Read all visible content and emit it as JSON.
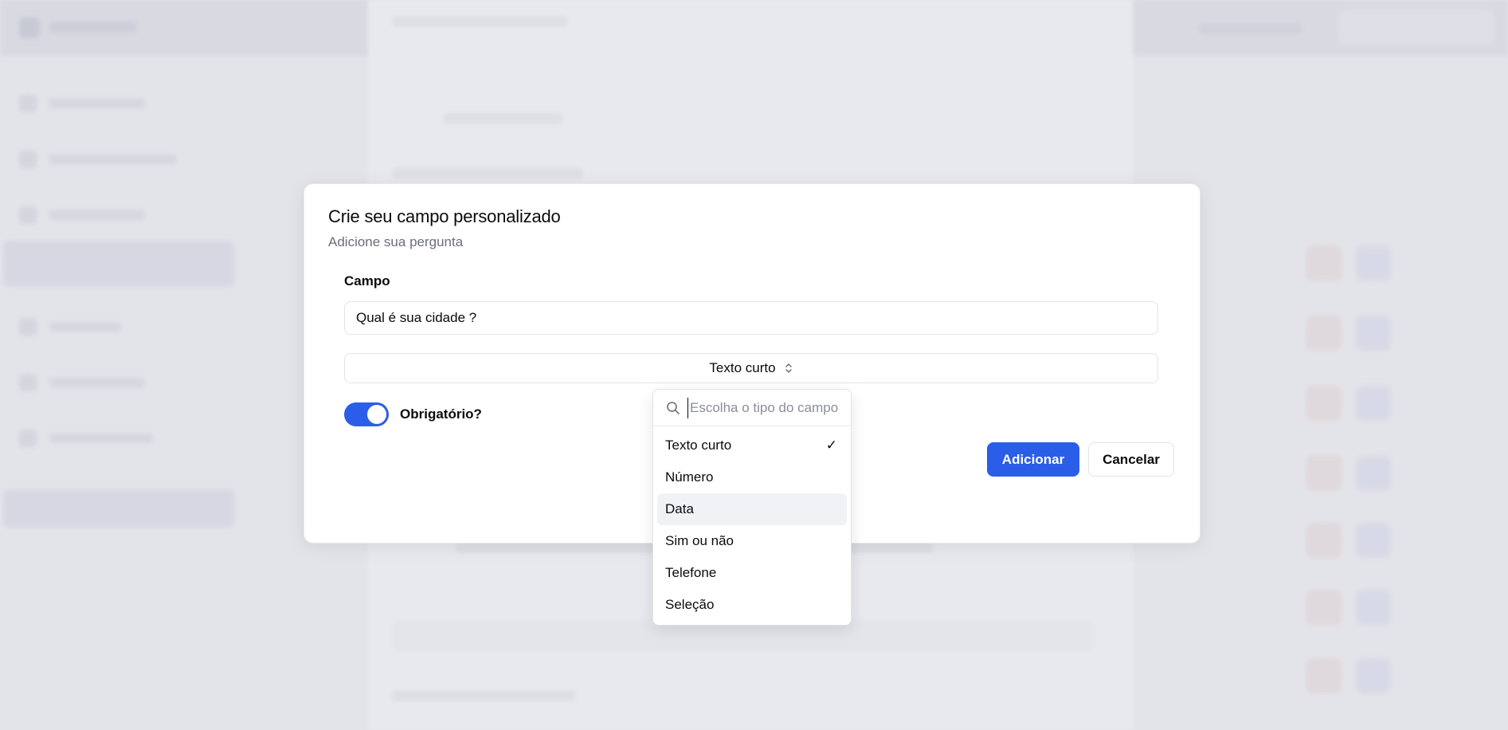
{
  "modal": {
    "title": "Crie seu campo personalizado",
    "subtitle": "Adicione sua pergunta",
    "field_label": "Campo",
    "field_value": "Qual é sua cidade ?",
    "type_selected": "Texto curto",
    "required_label": "Obrigatório?",
    "required_on": true,
    "add_button": "Adicionar",
    "cancel_button": "Cancelar"
  },
  "dropdown": {
    "search_placeholder": "Escolha o tipo do campo",
    "options": [
      {
        "label": "Texto curto",
        "selected": true
      },
      {
        "label": "Número"
      },
      {
        "label": "Data",
        "highlighted": true
      },
      {
        "label": "Sim ou não"
      },
      {
        "label": "Telefone"
      },
      {
        "label": "Seleção"
      }
    ],
    "check_glyph": "✓"
  },
  "colors": {
    "accent": "#2a5ee8",
    "overlay": "#e4e5ea",
    "highlight": "#f1f2f5"
  },
  "icons": [
    "search-icon",
    "chevron-up-down-icon",
    "check-icon"
  ]
}
